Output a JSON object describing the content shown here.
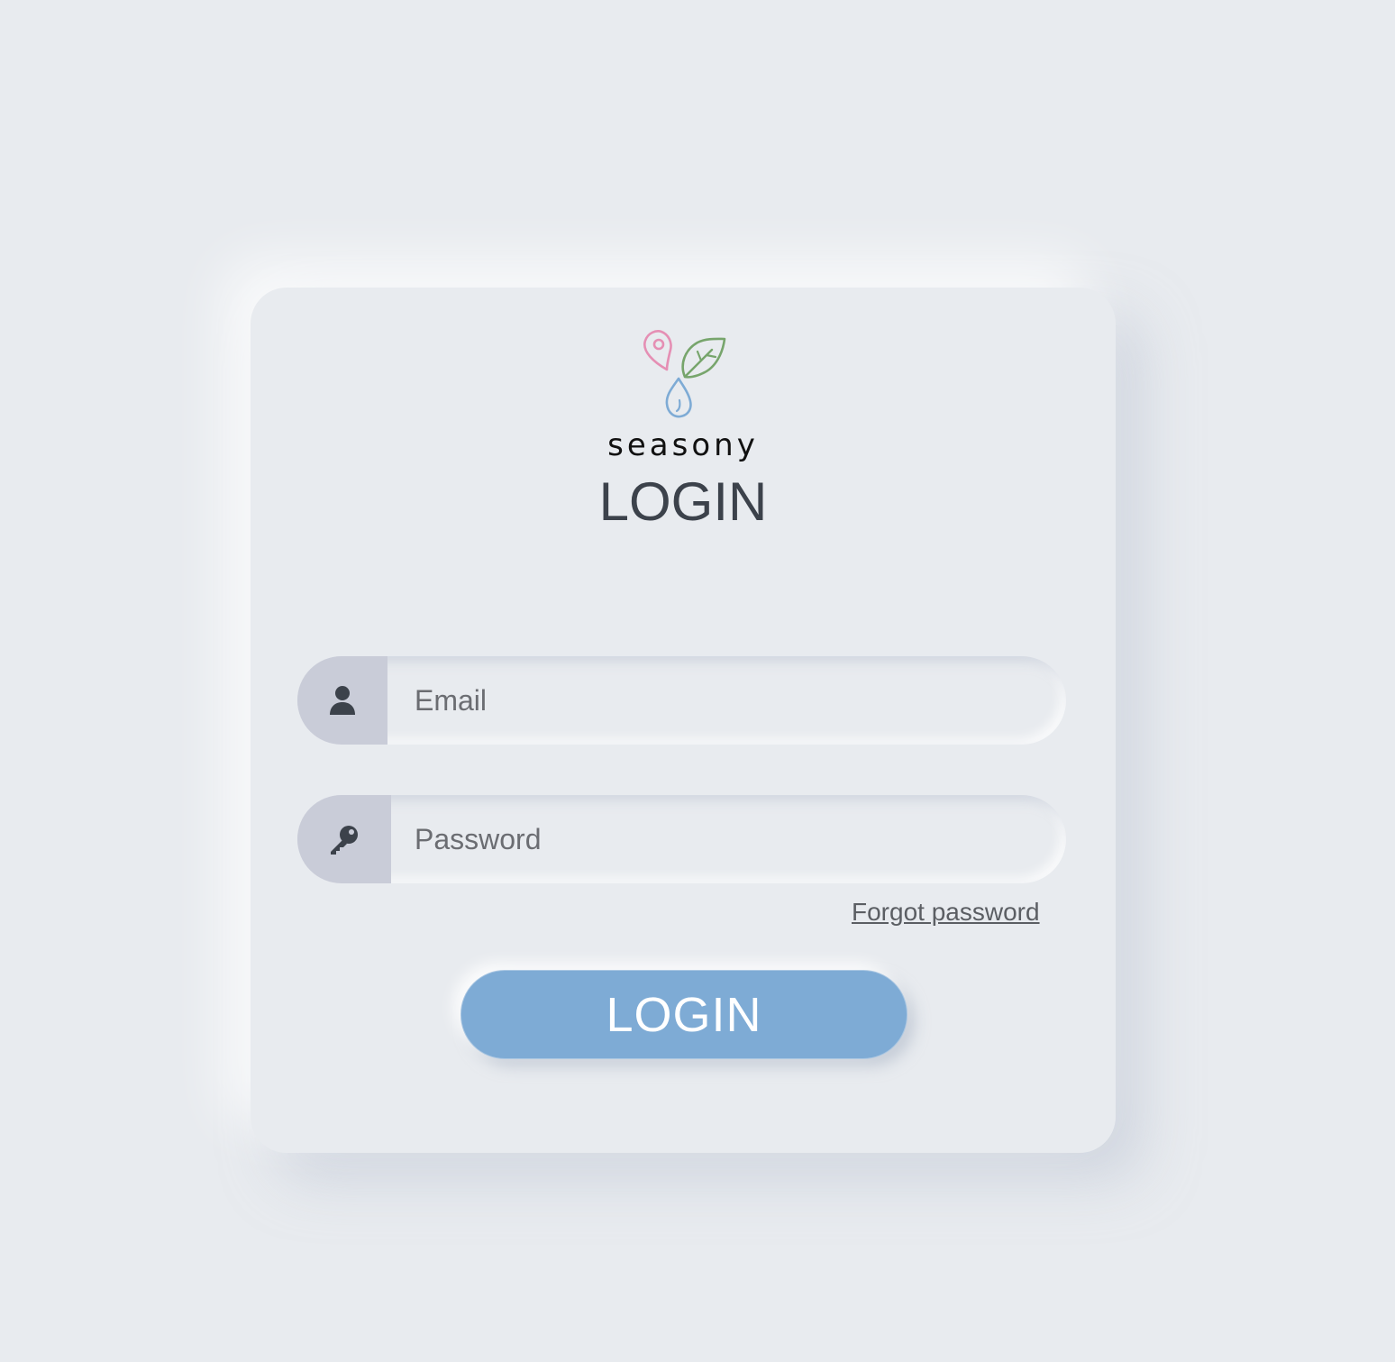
{
  "brand": {
    "name": "seasony",
    "logo_icon": "seasony-logo-icon",
    "logo_colors": {
      "pin": "#e58fb4",
      "leaf": "#77a56c",
      "drop": "#7eabd5"
    }
  },
  "page": {
    "title": "LOGIN",
    "background": "#e8ebef"
  },
  "form": {
    "email": {
      "icon": "user-icon",
      "placeholder": "Email",
      "value": ""
    },
    "password": {
      "icon": "key-icon",
      "placeholder": "Password",
      "value": ""
    },
    "forgot_password_label": "Forgot password",
    "submit_label": "LOGIN",
    "submit_color": "#7eabd5"
  }
}
